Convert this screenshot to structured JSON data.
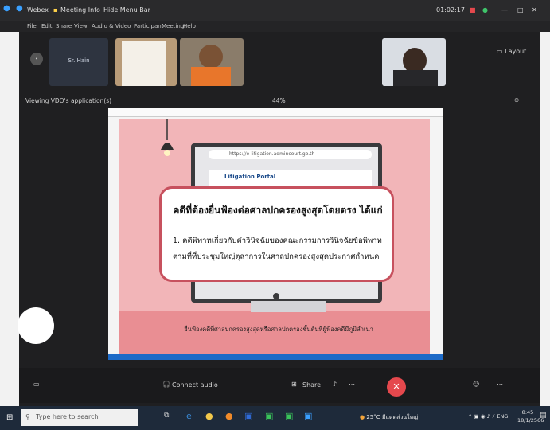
{
  "titlebar": {
    "app_name": "Webex",
    "meeting_info": "Meeting Info",
    "hide_menu_bar": "Hide Menu Bar",
    "timer": "01:02:17"
  },
  "menubar": [
    "File",
    "Edit",
    "Share",
    "View",
    "Audio & Video",
    "Participant",
    "Meeting",
    "Help"
  ],
  "thumbnails": {
    "name_label": "Sr. Hain",
    "layout_label": "Layout"
  },
  "viewbar": {
    "viewing": "Viewing VDO's application(s)",
    "zoom": "44%"
  },
  "slide": {
    "url": "https://e-litigation.admincourt.go.th",
    "portal_title": "Litigation Portal",
    "heading": "คดีที่ต้องยื่นฟ้องต่อศาลปกครองสูงสุดโดยตรง ได้แก่",
    "body_line1": "1. คดีพิพาทเกี่ยวกับคำวินิจฉัยของคณะกรรมการวินิจฉัยข้อพิพาท",
    "body_line2": "ตามที่ที่ประชุมใหญ่ตุลาการในศาลปกครองสูงสุดประกาศกำหนด",
    "subtitle": "ยื่นฟ้องคดีที่ศาลปกครองสูงสุดหรือศาลปกครองชั้นต้นที่ผู้ฟ้องคดีมีภูมิลำเนา"
  },
  "controls": {
    "connect_audio": "Connect audio",
    "share": "Share",
    "end_icon": "close-icon"
  },
  "taskbar": {
    "search_placeholder": "Type here to search",
    "weather": "25°C มีแดดส่วนใหญ่",
    "lang": "ENG",
    "time": "8:45",
    "date": "18/1/2566"
  }
}
